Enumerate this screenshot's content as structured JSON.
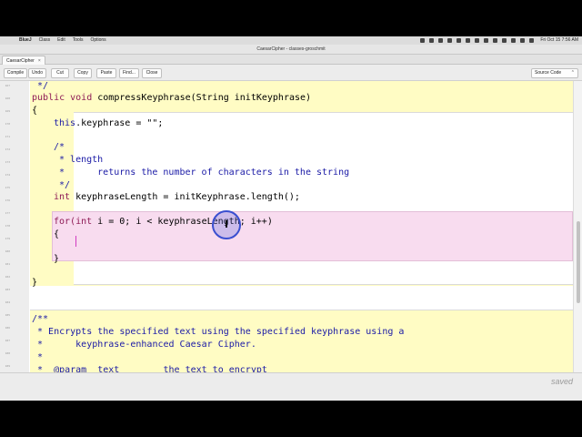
{
  "menubar": {
    "apple": "",
    "app_name": "BlueJ",
    "menus": [
      "Class",
      "Edit",
      "Tools",
      "Options"
    ],
    "clock": "Fri Oct 15  7:56 AM"
  },
  "window": {
    "title": "CaesarCipher - classes-groschmit"
  },
  "tab": {
    "label": "CaesarCipher",
    "close": "×"
  },
  "toolbar": {
    "buttons": [
      "Compile",
      "Undo",
      "Cut",
      "Copy",
      "Paste",
      "Find...",
      "Close"
    ],
    "view_select": "Source Code",
    "view_chevron": "⌃"
  },
  "editor": {
    "line_numbers": [
      "167",
      "168",
      "169",
      "170",
      "171",
      "172",
      "173",
      "174",
      "175",
      "176",
      "177",
      "178",
      "179",
      "180",
      "181",
      "182",
      "183",
      "184",
      "185",
      "186",
      "187",
      "188",
      "189"
    ],
    "lines": {
      "comment_end": " */",
      "sig_kw": "public void",
      "sig_rest": " compressKeyphrase(String initKeyphrase)",
      "open_brace": "{",
      "this_kw": "this",
      "assign_rest": ".keyphrase = \"\";",
      "c1": "/*",
      "c2": " * length",
      "c3": " *      returns the number of characters in the string",
      "c4": " */",
      "int_kw": "int",
      "decl_rest": " keyphraseLength = initKeyphrase.length();",
      "for_kw": "for(",
      "for_int": "int",
      "for_rest": " i = 0; i < keyphraseLength; i++)",
      "for_open": "{",
      "for_close": "}",
      "method_close": "}",
      "d1": "/**",
      "d2": " * Encrypts the specified text using the specified keyphrase using a",
      "d3": " *      keyphrase-enhanced Caesar Cipher.",
      "d4": " *",
      "d5": " *  @param  text        the text to encrypt"
    }
  },
  "status": {
    "saved": "saved"
  },
  "colors": {
    "method_scope": "#fffcc4",
    "loop_scope": "#f8dcef",
    "keyword": "#8e1a55",
    "comment": "#1a1aa6",
    "cursor_ring": "#3a4fd0"
  }
}
